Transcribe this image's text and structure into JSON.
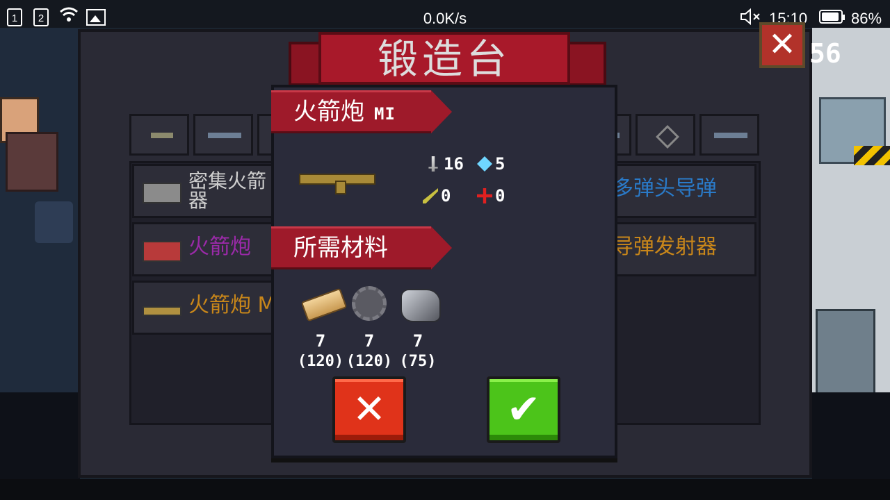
{
  "status_bar": {
    "sim1": "1",
    "sim2": "2",
    "network_speed": "0.0K/s",
    "time": "15:10",
    "battery_percent": "86%"
  },
  "forge": {
    "title": "锻造台",
    "close_label": "✕",
    "score_fragment": "56",
    "list_rows": [
      {
        "label": "密集火箭\n器",
        "color": "#cfcfcf"
      },
      {
        "label": "火箭炮",
        "color": "#9a2aa8"
      },
      {
        "label": "火箭炮 M",
        "color": "#c8861a"
      }
    ],
    "right_rows": [
      {
        "label": "多弹头导弹",
        "color": "#2a7ac8"
      },
      {
        "label": "导弹发射器",
        "color": "#c8861a"
      }
    ]
  },
  "dialog": {
    "weapon_name": "火箭炮",
    "weapon_tag": "MI",
    "stats": {
      "damage": "16",
      "energy": "5",
      "crit": "0",
      "accuracy": "0"
    },
    "materials_heading": "所需材料",
    "materials": [
      {
        "name": "wood",
        "required": "7",
        "owned": "(120)"
      },
      {
        "name": "gear",
        "required": "7",
        "owned": "(120)"
      },
      {
        "name": "ore",
        "required": "7",
        "owned": "(75)"
      }
    ],
    "cancel_label": "✕",
    "confirm_label": "✔"
  }
}
